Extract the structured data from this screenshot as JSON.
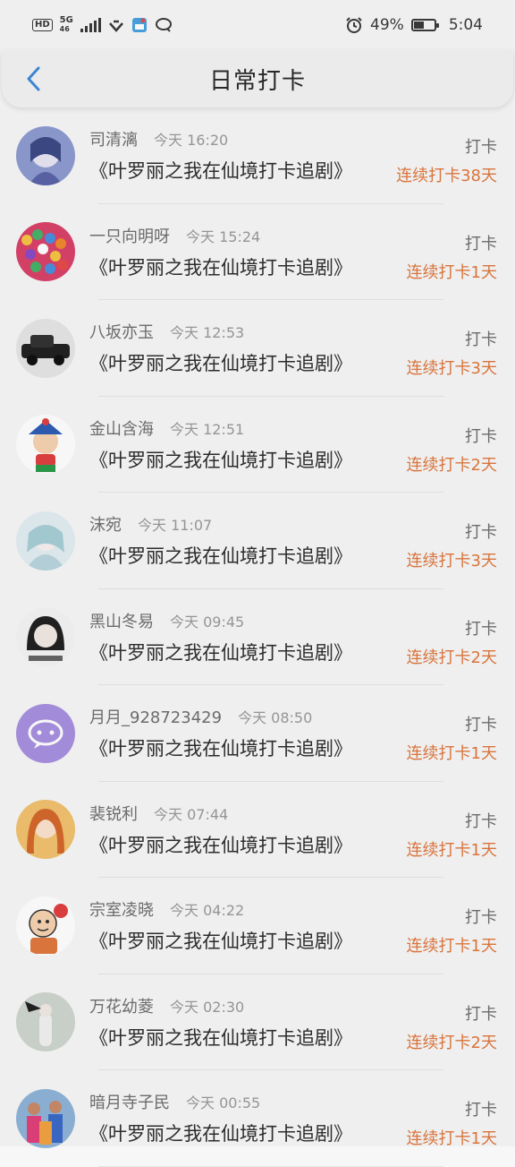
{
  "status_bar": {
    "hd": "HD",
    "net_top": "5G",
    "net_bottom": "46",
    "battery_text": "49%",
    "battery_level": 0.49,
    "time": "5:04",
    "icons": [
      "hd-icon",
      "signal-icon",
      "wifi-icon",
      "app-notification-icon",
      "chat-icon",
      "alarm-icon",
      "battery-icon"
    ]
  },
  "header": {
    "title": "日常打卡",
    "back_icon": "chevron-left-icon",
    "accent": "#3d8bd9"
  },
  "colors": {
    "streak": "#e0783e",
    "username": "#6f6f6f",
    "time": "#9a9a9a"
  },
  "items": [
    {
      "username": "司清漓",
      "time": "今天 16:20",
      "title": "《叶罗丽之我在仙境打卡追剧》",
      "action": "打卡",
      "streak": "连续打卡38天",
      "avatar": "anime-girl-avatar"
    },
    {
      "username": "一只向明呀",
      "time": "今天 15:24",
      "title": "《叶罗丽之我在仙境打卡追剧》",
      "action": "打卡",
      "streak": "连续打卡1天",
      "avatar": "candy-avatar"
    },
    {
      "username": "八坂亦玉",
      "time": "今天 12:53",
      "title": "《叶罗丽之我在仙境打卡追剧》",
      "action": "打卡",
      "streak": "连续打卡3天",
      "avatar": "vintage-car-avatar"
    },
    {
      "username": "金山含海",
      "time": "今天 12:51",
      "title": "《叶罗丽之我在仙境打卡追剧》",
      "action": "打卡",
      "streak": "连续打卡2天",
      "avatar": "cartoon-boy-avatar"
    },
    {
      "username": "沫宛",
      "time": "今天 11:07",
      "title": "《叶罗丽之我在仙境打卡追剧》",
      "action": "打卡",
      "streak": "连续打卡3天",
      "avatar": "pastel-anime-avatar"
    },
    {
      "username": "黑山冬易",
      "time": "今天 09:45",
      "title": "《叶罗丽之我在仙境打卡追剧》",
      "action": "打卡",
      "streak": "连续打卡2天",
      "avatar": "sketch-girl-avatar"
    },
    {
      "username": "月月_928723429",
      "time": "今天 08:50",
      "title": "《叶罗丽之我在仙境打卡追剧》",
      "action": "打卡",
      "streak": "连续打卡1天",
      "avatar": "chat-bubble-avatar"
    },
    {
      "username": "裴锐利",
      "time": "今天 07:44",
      "title": "《叶罗丽之我在仙境打卡追剧》",
      "action": "打卡",
      "streak": "连续打卡1天",
      "avatar": "orange-anime-avatar"
    },
    {
      "username": "宗室凌晓",
      "time": "今天 04:22",
      "title": "《叶罗丽之我在仙境打卡追剧》",
      "action": "打卡",
      "streak": "连续打卡1天",
      "avatar": "cartoon-man-avatar"
    },
    {
      "username": "万花幼菱",
      "time": "今天 02:30",
      "title": "《叶罗丽之我在仙境打卡追剧》",
      "action": "打卡",
      "streak": "连续打卡2天",
      "avatar": "bird-figure-avatar"
    },
    {
      "username": "暗月寺子民",
      "time": "今天 00:55",
      "title": "《叶罗丽之我在仙境打卡追剧》",
      "action": "打卡",
      "streak": "连续打卡1天",
      "avatar": "cycling-group-avatar"
    }
  ]
}
